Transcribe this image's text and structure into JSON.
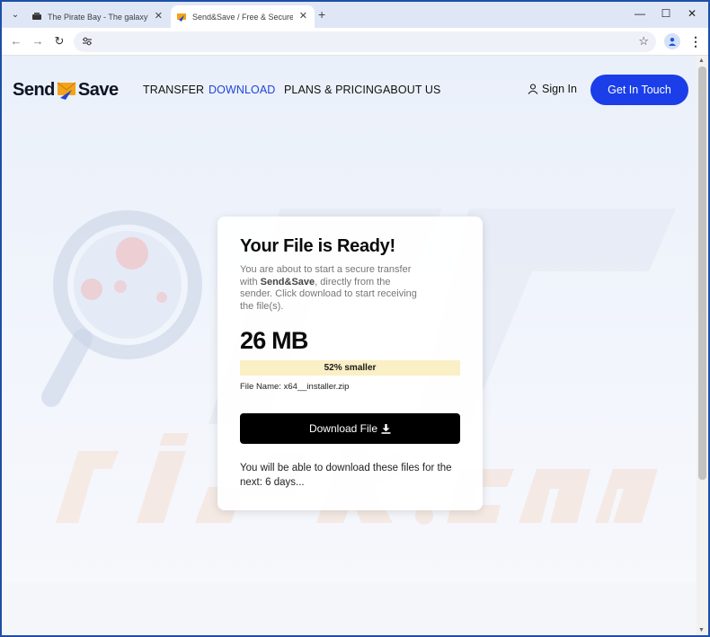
{
  "browser": {
    "tabs": [
      {
        "title": "The Pirate Bay - The galaxy's m",
        "active": false
      },
      {
        "title": "Send&Save / Free & Secure File",
        "active": true
      }
    ],
    "address": "",
    "icons": [
      "tab-search-icon",
      "close-icon",
      "new-tab-icon",
      "minimize-icon",
      "maximize-icon",
      "window-close-icon",
      "back-icon",
      "forward-icon",
      "reload-icon",
      "site-settings-icon",
      "bookmark-star-icon",
      "profile-icon",
      "menu-icon"
    ]
  },
  "site": {
    "logo_left": "Send",
    "logo_right": "Save",
    "nav": [
      "TRANSFER",
      "DOWNLOAD",
      "PLANS & PRICING",
      "ABOUT US"
    ],
    "active_nav": "DOWNLOAD",
    "signin_label": "Sign In",
    "cta_label": "Get In Touch",
    "accent_color": "#1b3ee8"
  },
  "card": {
    "title": "Your File is Ready!",
    "desc_before": "You are about to start a secure transfer with ",
    "desc_brand": "Send&Save",
    "desc_after": ", directly from the sender. Click download to start receiving the file(s).",
    "size": "26 MB",
    "badge": "52% smaller",
    "file_name": "File Name: x64__installer.zip",
    "download_label": "Download File",
    "note": "You will be able to download these files for the next: 6 days..."
  }
}
